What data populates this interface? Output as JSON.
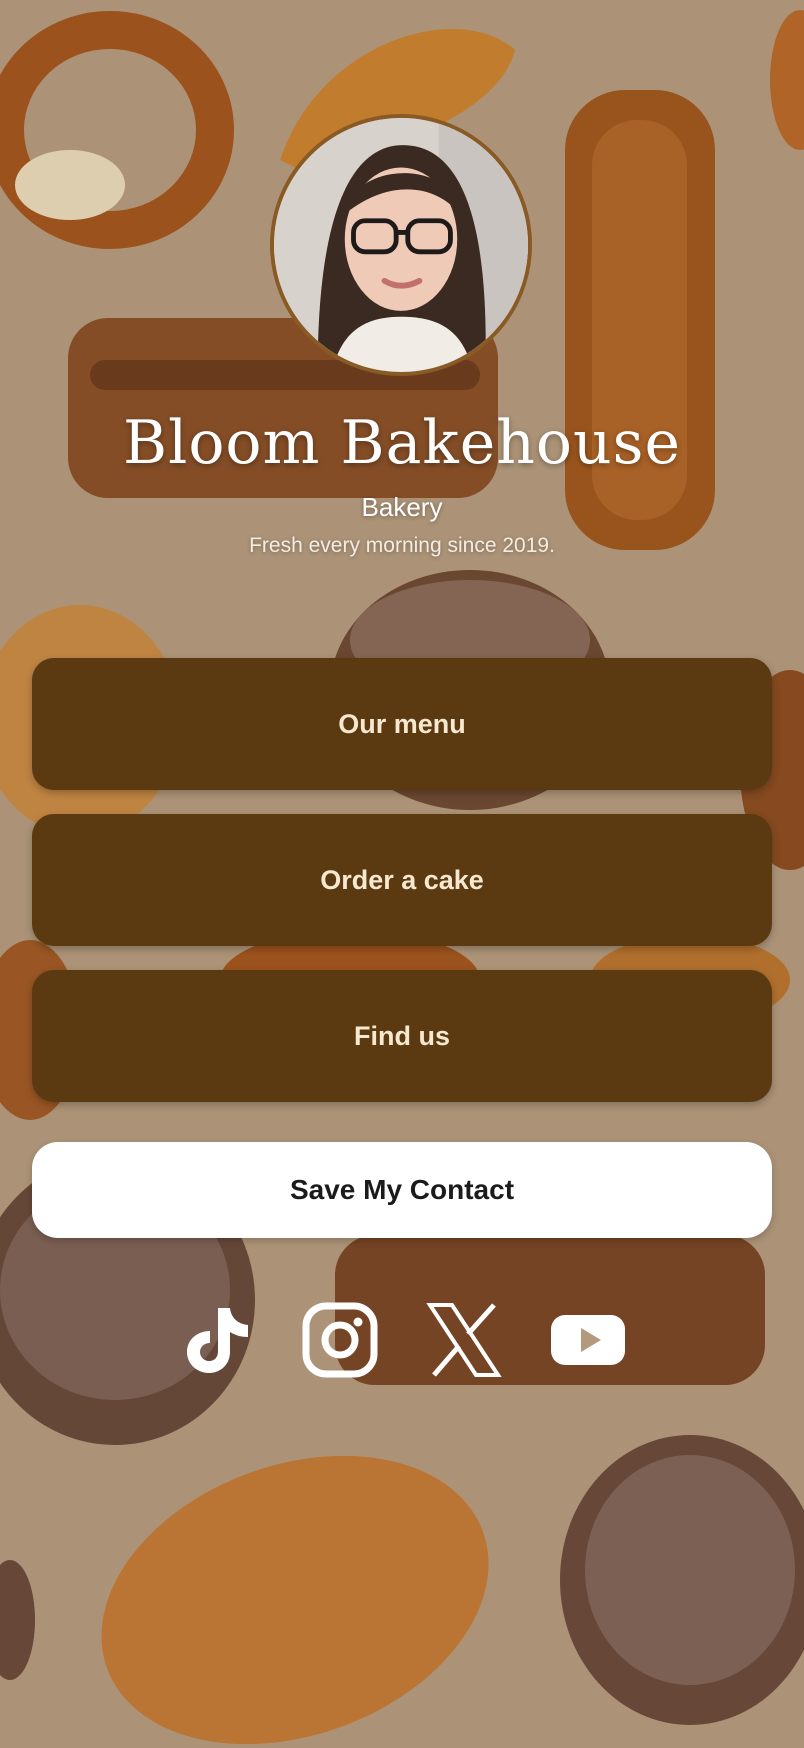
{
  "profile": {
    "name": "Bloom Bakehouse",
    "category": "Bakery",
    "tagline": "Fresh every morning since 2019."
  },
  "links": [
    {
      "label": "Our menu"
    },
    {
      "label": "Order a cake"
    },
    {
      "label": "Find us"
    }
  ],
  "save_contact": {
    "label": "Save My Contact"
  },
  "socials": [
    {
      "icon": "tiktok-icon"
    },
    {
      "icon": "instagram-icon"
    },
    {
      "icon": "x-icon"
    },
    {
      "icon": "youtube-icon"
    }
  ],
  "colors": {
    "background": "#b39a7c",
    "button": "#5b3a12",
    "button_text": "#f7e8cf",
    "save_button": "#ffffff",
    "avatar_border": "#8a5a25"
  }
}
